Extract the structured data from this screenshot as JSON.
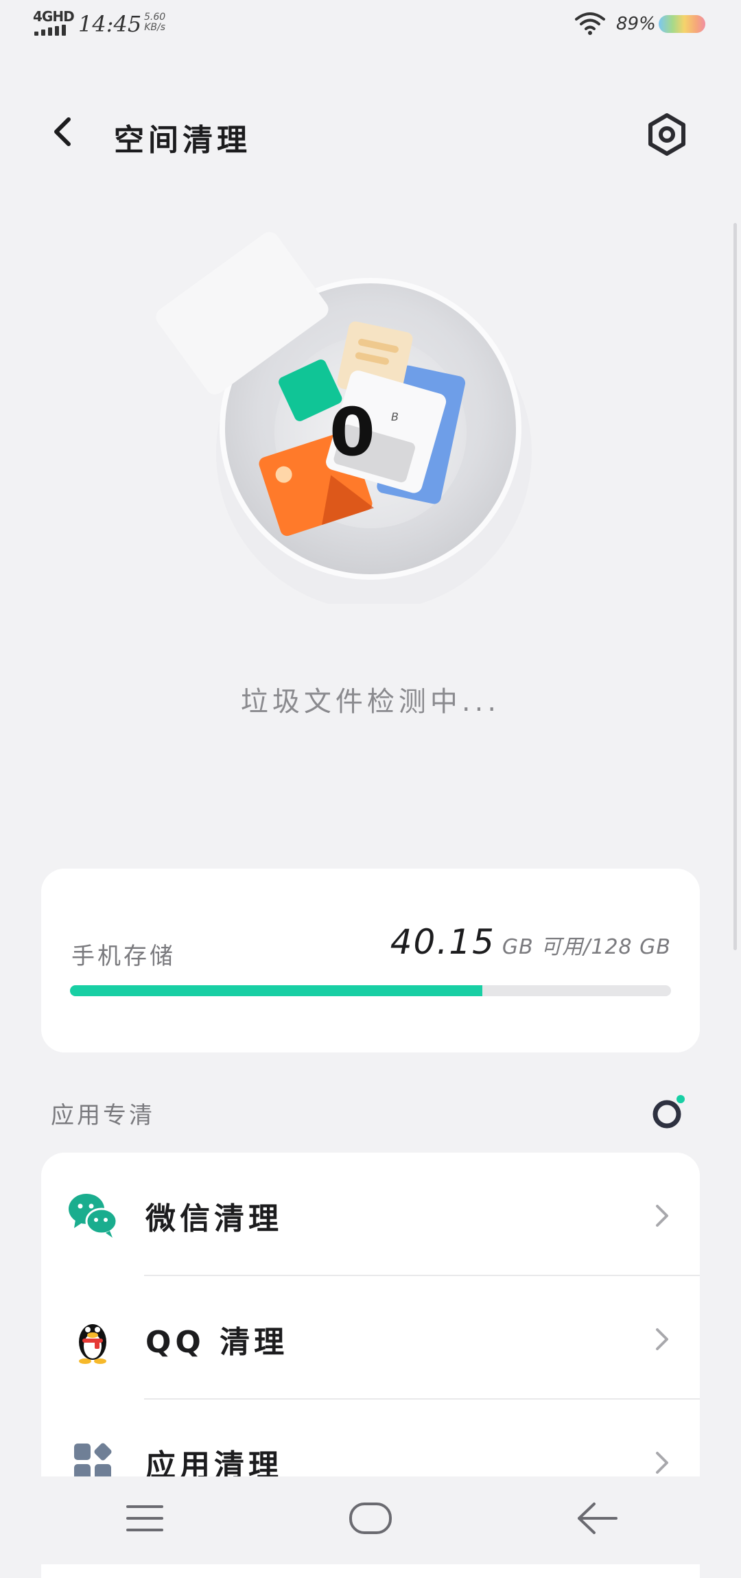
{
  "status_bar": {
    "network": "4GHD",
    "time": "14:45",
    "speed_value": "5.60",
    "speed_unit": "KB/s",
    "battery": "89%"
  },
  "header": {
    "title": "空间清理",
    "back_icon": "back-arrow-icon",
    "settings_icon": "settings-hexagon-icon"
  },
  "hero": {
    "size_value": "0",
    "size_unit": "B",
    "scan_status": "垃圾文件检测中..."
  },
  "storage": {
    "label": "手机存储",
    "free": "40.15",
    "rest": "GB 可用/128 GB",
    "used_fraction": 0.686,
    "bar_color": "#18cfa4"
  },
  "app_section": {
    "title": "应用专清",
    "icon": "ring-dot-icon",
    "items": [
      {
        "label": "微信清理",
        "icon": "wechat-icon"
      },
      {
        "label": "QQ 清理",
        "icon": "qq-penguin-icon"
      },
      {
        "label": "应用清理",
        "icon": "app-blocks-icon"
      }
    ]
  },
  "nav_bar": {
    "buttons": [
      "menu-icon",
      "home-icon",
      "back-icon"
    ]
  }
}
